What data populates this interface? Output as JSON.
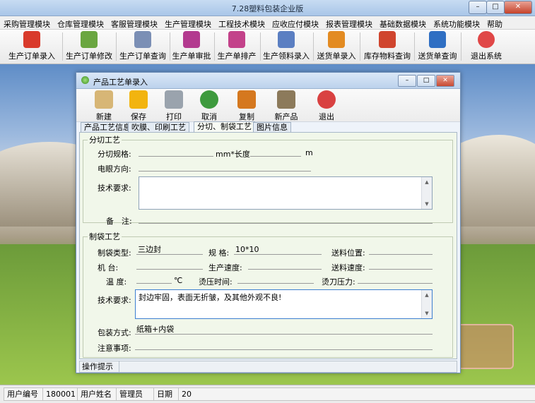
{
  "window": {
    "title": "7.28塑料包装企业版"
  },
  "menu": [
    "采购管理模块",
    "仓库管理模块",
    "客服管理模块",
    "生产管理模块",
    "工程技术模块",
    "应收应付模块",
    "报表管理模块",
    "基础数据模块",
    "系统功能模块",
    "帮助"
  ],
  "toolbar": [
    {
      "label": "生产订单录入",
      "icon": "pdf-icon",
      "color": "#d93a2b"
    },
    {
      "label": "生产订单修改",
      "icon": "flower-icon",
      "color": "#6aa640"
    },
    {
      "label": "生产订单查询",
      "icon": "document-search-icon",
      "color": "#7b8fb5"
    },
    {
      "label": "生产单审批",
      "icon": "pen-approve-icon",
      "color": "#b33a8f"
    },
    {
      "label": "生产单排产",
      "icon": "schedule-icon",
      "color": "#c3428a"
    },
    {
      "label": "生产领料录入",
      "icon": "material-icon",
      "color": "#5b7fc2"
    },
    {
      "label": "送货单录入",
      "icon": "delivery-icon",
      "color": "#e38b22"
    },
    {
      "label": "库存物料查询",
      "icon": "inventory-icon",
      "color": "#d0452e"
    },
    {
      "label": "送货单查询",
      "icon": "feather-icon",
      "color": "#2f6fc3"
    },
    {
      "label": "退出系统",
      "icon": "exit-icon",
      "color": "#e04747"
    }
  ],
  "dialog": {
    "title": "产品工艺单录入",
    "tools": [
      {
        "label": "新建",
        "icon": "new-doc-icon",
        "color": "#d7b676"
      },
      {
        "label": "保存",
        "icon": "save-icon",
        "color": "#f2b40f"
      },
      {
        "label": "打印",
        "icon": "printer-icon",
        "color": "#9aa3ad"
      },
      {
        "label": "取消",
        "icon": "undo-icon",
        "color": "#3e9a3e"
      },
      {
        "label": "复制",
        "icon": "copy-icon",
        "color": "#d5781f"
      },
      {
        "label": "新产品",
        "icon": "new-product-icon",
        "color": "#8c7a5b"
      },
      {
        "label": "退出",
        "icon": "exit-icon",
        "color": "#d94141"
      }
    ],
    "tabs": [
      "产品工艺信息",
      "吹膜、印刷工艺",
      "分切、制袋工艺",
      "图片信息"
    ],
    "active_tab": 2,
    "cut": {
      "legend": "分切工艺",
      "spec_label": "分切规格:",
      "spec_value": "",
      "unit_mm": "mm*长度",
      "length_value": "",
      "unit_m": "m",
      "direction_label": "电眼方向:",
      "direction_value": "",
      "tech_label": "技术要求:",
      "tech_value": "",
      "note_label": "备　注:",
      "note_value": ""
    },
    "bag": {
      "legend": "制袋工艺",
      "type_label": "制袋类型:",
      "type_value": "三边封",
      "spec_label": "规 格:",
      "spec_value": "10*10",
      "feed_pos_label": "送料位置:",
      "feed_pos_value": "",
      "machine_label": "机 台:",
      "machine_value": "",
      "speed_label": "生产速度:",
      "speed_value": "",
      "feed_speed_label": "送料速度:",
      "feed_speed_value": "",
      "temp_label": "温 度:",
      "temp_value": "",
      "temp_unit": "℃",
      "press_time_label": "烫压时间:",
      "press_time_value": "",
      "blade_label": "烫刀压力:",
      "blade_value": "",
      "tech_label": "技术要求:",
      "tech_value": "封边牢固，表面无折皱，及其他外观不良!",
      "pack_label": "包装方式:",
      "pack_value": "纸箱+内袋",
      "attention_label": "注意事项:",
      "attention_value": ""
    },
    "status_label": "操作提示"
  },
  "statusbar": {
    "user_no_label": "用户编号",
    "user_no": "180001",
    "user_name_label": "用户姓名",
    "user_name": "管理员",
    "date_label": "日期",
    "date": "20"
  }
}
